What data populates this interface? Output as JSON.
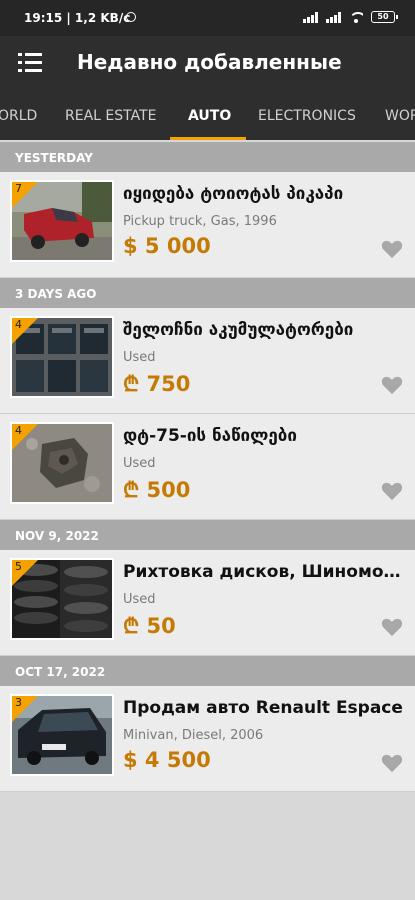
{
  "status_bar": {
    "time": "19:15 | 1,2 KB/c",
    "battery": "50"
  },
  "app_bar": {
    "title": "Недавно добавленные"
  },
  "tabs": [
    {
      "label": "ORLD",
      "active": false
    },
    {
      "label": "REAL ESTATE",
      "active": false
    },
    {
      "label": "AUTO",
      "active": true
    },
    {
      "label": "ELECTRONICS",
      "active": false
    },
    {
      "label": "WOR",
      "active": false
    }
  ],
  "sections": [
    {
      "header": "YESTERDAY",
      "items": [
        {
          "badge": "7",
          "title": "იყიდება ტოიოტას პიკაპი",
          "subtitle": "Pickup truck, Gas, 1996",
          "price": "$ 5 000",
          "thumb": "red-pickup"
        }
      ]
    },
    {
      "header": "3 DAYS AGO",
      "items": [
        {
          "badge": "4",
          "title": "შელოჩნი აკუმულატორები",
          "subtitle": "Used",
          "price": "₾ 750",
          "thumb": "batteries"
        },
        {
          "badge": "4",
          "title": "დტ-75-ის ნაწილები",
          "subtitle": "Used",
          "price": "₾ 500",
          "thumb": "engine-part"
        }
      ]
    },
    {
      "header": "NOV 9, 2022",
      "items": [
        {
          "badge": "5",
          "title": "Рихтовка дисков, Шиномонтаж",
          "subtitle": "Used",
          "price": "₾ 50",
          "thumb": "tires"
        }
      ]
    },
    {
      "header": "OCT 17, 2022",
      "items": [
        {
          "badge": "3",
          "title": "Продам авто Renault Espace",
          "subtitle": "Minivan, Diesel, 2006",
          "price": "$ 4 500",
          "thumb": "minivan"
        }
      ]
    }
  ],
  "colors": {
    "accent": "#f5a200",
    "price": "#c57a05",
    "header_bg": "#a9a9a9",
    "bar_bg": "#2e2e2e"
  }
}
